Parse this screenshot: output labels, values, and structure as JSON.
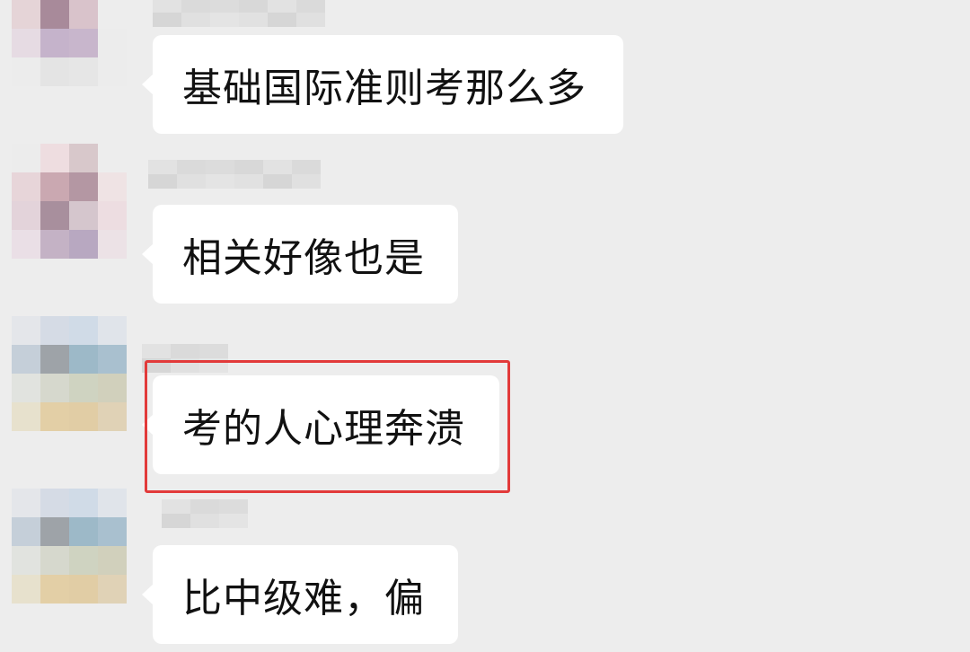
{
  "messages": [
    {
      "text": "基础国际准则考那么多",
      "avatar_palette": [
        "#ececec",
        "#d9b6bc",
        "#b8939e",
        "#ececec",
        "#e5d4d7",
        "#a88a9a",
        "#d9c3cb",
        "#ededed",
        "#e6dbe3",
        "#c5b3cb",
        "#c8b6cc",
        "#ececec",
        "#ececec",
        "#e4e4e4",
        "#e6e6e6",
        "#ececec"
      ]
    },
    {
      "text": "相关好像也是",
      "avatar_palette": [
        "#ececec",
        "#eedde0",
        "#d8c8cb",
        "#ededed",
        "#e7d5d9",
        "#caa8b1",
        "#b497a3",
        "#efe3e4",
        "#e3d3da",
        "#a88f9d",
        "#d5c6cd",
        "#eddde1",
        "#eadfe6",
        "#c4b2c5",
        "#b8a8c1",
        "#ece2e6"
      ]
    },
    {
      "text": "考的人心理奔溃",
      "avatar_palette": [
        "#e4e6ea",
        "#d5dbe5",
        "#d0dbe7",
        "#e0e4ea",
        "#c5cfd9",
        "#9ea3a8",
        "#9db9c8",
        "#a9c0cf",
        "#e1e3df",
        "#d6d8cd",
        "#cfd3c1",
        "#d1d0bc",
        "#e7e1cd",
        "#e3cfa6",
        "#e1cda5",
        "#e0d2b6"
      ]
    },
    {
      "text": "比中级难，偏",
      "avatar_palette": [
        "#e4e6ea",
        "#d5dbe5",
        "#d0dbe7",
        "#e0e4ea",
        "#c5cfd9",
        "#9ea3a8",
        "#9db9c8",
        "#a9c0cf",
        "#e1e3df",
        "#d6d8cd",
        "#cfd3c1",
        "#d1d0bc",
        "#e7e1cd",
        "#e3cfa6",
        "#e1cda5",
        "#e0d2b6"
      ]
    }
  ],
  "name_palette": [
    "#e2e2e2",
    "#d6d6d6",
    "#dadada",
    "#e0e0e0",
    "#dcdcdc",
    "#e4e4e4",
    "#d8d8d8",
    "#e1e1e1"
  ],
  "colors": {
    "background": "#ededed",
    "bubble": "#ffffff",
    "text": "#111111",
    "highlight_border": "#e23a3a"
  }
}
